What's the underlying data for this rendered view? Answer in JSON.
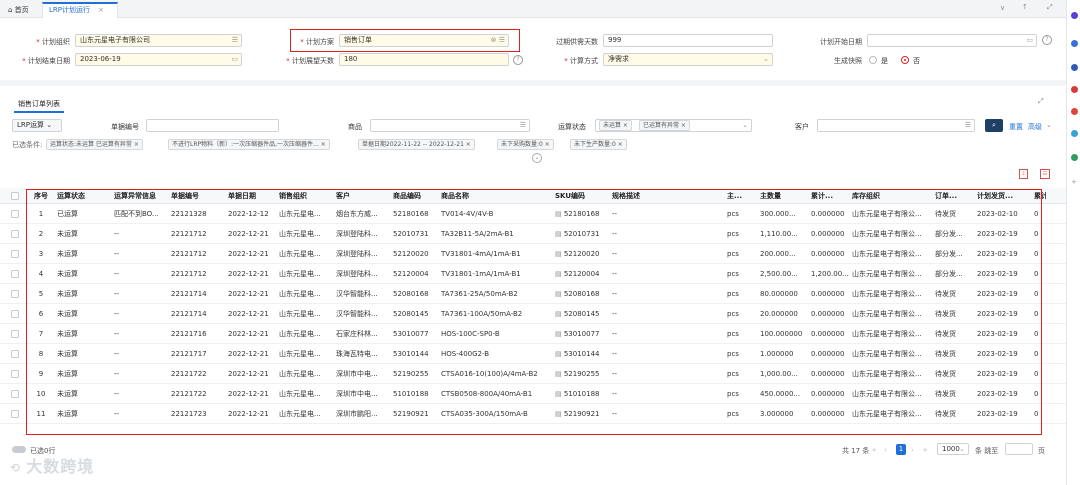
{
  "tabs": {
    "home": "首页",
    "active": "LRP计划运行",
    "close": "×"
  },
  "window_controls": {
    "collapse": "∨",
    "up": "↑",
    "expand": "⤢"
  },
  "form": {
    "org_label": "计划组织",
    "org_value": "山东元星电子有限公司",
    "plan_label": "计划方案",
    "plan_value": "销售订单",
    "overdue_label": "过期供需天数",
    "overdue_value": "999",
    "start_label": "计划开始日期",
    "start_value": "",
    "end_label": "计划结束日期",
    "end_value": "2023-06-19",
    "view_label": "计划展望天数",
    "view_value": "180",
    "calc_label": "计算方式",
    "calc_value": "净需求",
    "snapshot_label": "生成快照",
    "snapshot_yes": "是",
    "snapshot_no": "否"
  },
  "orders": {
    "title": "销售订单列表",
    "lrp_btn": "LRP运算",
    "doc_no_label": "单据编号",
    "product_label": "商品",
    "status_label": "运算状态",
    "status_tag1": "未运算",
    "status_tag2": "已运算有异常",
    "customer_label": "客户",
    "reset": "重置",
    "advanced": "高级",
    "conditions_label": "已选条件:",
    "cond1": "运算状态:未运算 已运算有异常",
    "cond2": "不进行LRP物料（新）:一次压缩器件品,一次压缩器件...",
    "cond3": "单据日期2022-11-22 -- 2022-12-21",
    "cond4": "未下采购数量:0",
    "cond5": "未下生产数量:0"
  },
  "columns": [
    "序号",
    "运算状态",
    "运算异常信息",
    "单据编号",
    "单据日期",
    "销售组织",
    "客户",
    "商品编码",
    "商品名称",
    "SKU编码",
    "规格描述",
    "主...",
    "主数量",
    "累计...",
    "库存组织",
    "订单...",
    "计划发货...",
    "累计"
  ],
  "rows": [
    [
      "1",
      "已运算",
      "匹配不到BO...",
      "22121328",
      "2022-12-12",
      "山东元星电...",
      "烟台东方威...",
      "52180168",
      "TV014-4V/4V-B",
      "52180168",
      "--",
      "pcs",
      "300.000...",
      "0.000000",
      "山东元星电子有限公...",
      "待发货",
      "2023-02-10",
      "0"
    ],
    [
      "2",
      "未运算",
      "--",
      "22121712",
      "2022-12-21",
      "山东元星电...",
      "深圳登陆科...",
      "52010731",
      "TA32B11-5A/2mA-B1",
      "52010731",
      "--",
      "pcs",
      "1,110.00...",
      "0.000000",
      "山东元星电子有限公...",
      "部分发...",
      "2023-02-19",
      "0"
    ],
    [
      "3",
      "未运算",
      "--",
      "22121712",
      "2022-12-21",
      "山东元星电...",
      "深圳登陆科...",
      "52120020",
      "TV31801-4mA/1mA-B1",
      "52120020",
      "--",
      "pcs",
      "200.000...",
      "0.000000",
      "山东元星电子有限公...",
      "部分发...",
      "2023-02-19",
      "0"
    ],
    [
      "4",
      "未运算",
      "--",
      "22121712",
      "2022-12-21",
      "山东元星电...",
      "深圳登陆科...",
      "52120004",
      "TV31801-1mA/1mA-B1",
      "52120004",
      "--",
      "pcs",
      "2,500.00...",
      "1,200.00...",
      "山东元星电子有限公...",
      "部分发...",
      "2023-02-19",
      "0"
    ],
    [
      "5",
      "未运算",
      "--",
      "22121714",
      "2022-12-21",
      "山东元星电...",
      "汉华智能科...",
      "52080168",
      "TA7361-25A/50mA-B2",
      "52080168",
      "--",
      "pcs",
      "80.000000",
      "0.000000",
      "山东元星电子有限公...",
      "待发货",
      "2023-02-19",
      "0"
    ],
    [
      "6",
      "未运算",
      "--",
      "22121714",
      "2022-12-21",
      "山东元星电...",
      "汉华智能科...",
      "52080145",
      "TA7361-100A/50mA-B2",
      "52080145",
      "--",
      "pcs",
      "20.000000",
      "0.000000",
      "山东元星电子有限公...",
      "待发货",
      "2023-02-19",
      "0"
    ],
    [
      "7",
      "未运算",
      "--",
      "22121716",
      "2022-12-21",
      "山东元星电...",
      "石家庄科林...",
      "53010077",
      "HOS-100C-SP0-B",
      "53010077",
      "--",
      "pcs",
      "100.000000",
      "0.000000",
      "山东元星电子有限公...",
      "待发货",
      "2023-02-19",
      "0"
    ],
    [
      "8",
      "未运算",
      "--",
      "22121717",
      "2022-12-21",
      "山东元星电...",
      "珠海瓦特电...",
      "53010144",
      "HOS-400G2-B",
      "53010144",
      "--",
      "pcs",
      "1.000000",
      "0.000000",
      "山东元星电子有限公...",
      "待发货",
      "2023-02-19",
      "0"
    ],
    [
      "9",
      "未运算",
      "--",
      "22121722",
      "2022-12-21",
      "山东元星电...",
      "深圳市中电...",
      "52190255",
      "CTSA016-10(100)A/4mA-B2",
      "52190255",
      "--",
      "pcs",
      "1,000.00...",
      "0.000000",
      "山东元星电子有限公...",
      "待发货",
      "2023-02-19",
      "0"
    ],
    [
      "10",
      "未运算",
      "--",
      "22121722",
      "2022-12-21",
      "山东元星电...",
      "深圳市中电...",
      "51010188",
      "CTSB0508-800A/40mA-B1",
      "51010188",
      "--",
      "pcs",
      "450.0000...",
      "0.000000",
      "山东元星电子有限公...",
      "待发货",
      "2023-02-19",
      "0"
    ],
    [
      "11",
      "未运算",
      "--",
      "22121723",
      "2022-12-21",
      "山东元星电...",
      "深圳市鹏阳...",
      "52190921",
      "CTSA035-300A/150mA-B",
      "52190921",
      "--",
      "pcs",
      "3.000000",
      "0.000000",
      "山东元星电子有限公...",
      "待发货",
      "2023-02-19",
      "0"
    ]
  ],
  "footer": {
    "selected": "已选0行",
    "total": "共 17 条",
    "page": "1",
    "page_size": "1000",
    "goto_label": "条 跳至",
    "goto_suffix": "页"
  },
  "watermark": "大数跨境"
}
